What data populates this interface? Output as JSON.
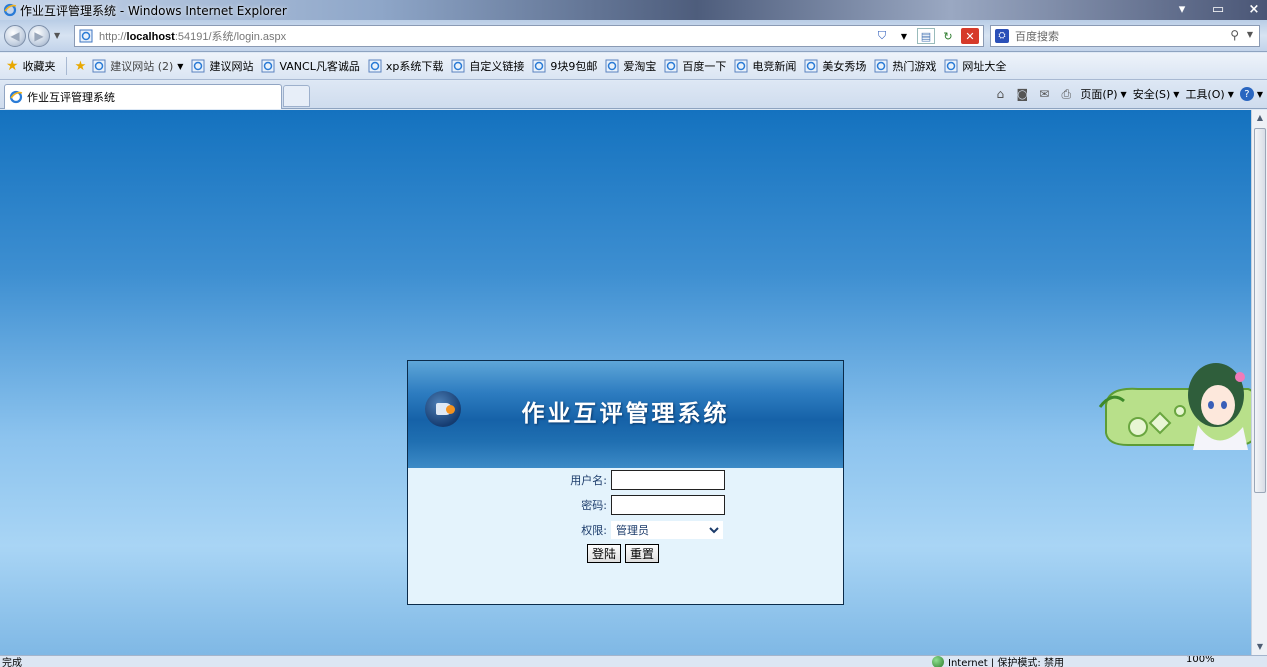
{
  "window": {
    "title": "作业互评管理系统 - Windows Internet Explorer",
    "minimize": "▾",
    "maximize": "▭",
    "close": "×"
  },
  "address_bar": {
    "url_prefix": "http://",
    "url_host": "localhost",
    "url_rest": ":54191/系统/login.aspx",
    "search_placeholder": "百度搜索"
  },
  "favorites_bar": {
    "favorites_label": "收藏夹",
    "suggested_sites": "建议网站 (2)",
    "items": [
      "建议网站",
      "VANCL凡客诚品",
      "xp系统下载",
      "自定义链接",
      "9块9包邮",
      "爱淘宝",
      "百度一下",
      "电竞新闻",
      "美女秀场",
      "热门游戏",
      "网址大全"
    ]
  },
  "tabs": [
    {
      "label": "作业互评管理系统"
    }
  ],
  "command_bar": {
    "page": "页面(P)",
    "safety": "安全(S)",
    "tools": "工具(O)"
  },
  "login": {
    "title": "作业互评管理系统",
    "username_label": "用户名:",
    "username_value": "",
    "password_label": "密码:",
    "password_value": "",
    "role_label": "权限:",
    "role_selected": "管理员",
    "login_button": "登陆",
    "reset_button": "重置"
  },
  "status_bar": {
    "status": "完成",
    "zone": "Internet | 保护模式: 禁用",
    "zoom": "100%"
  },
  "colors": {
    "header_blue": "#1662a8",
    "content_top": "#1472bf",
    "panel_bg": "#e4f3fc",
    "logo_orange": "#f5931f"
  }
}
